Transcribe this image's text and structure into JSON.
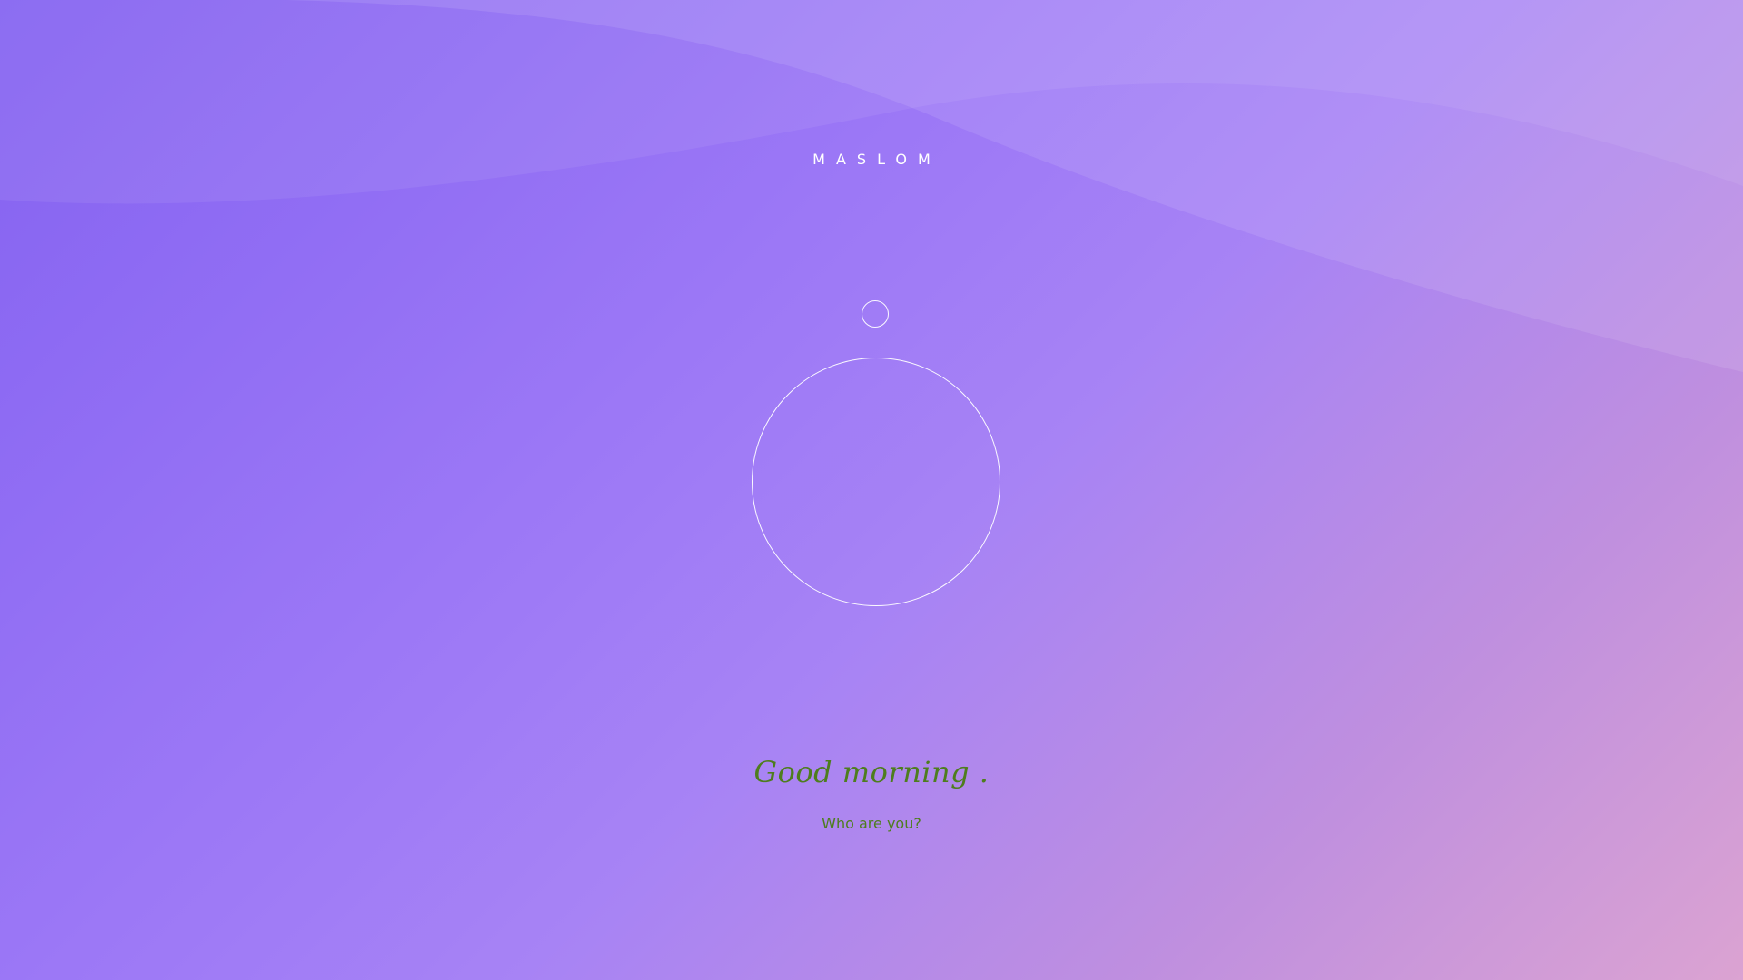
{
  "app": {
    "brand": "MASLOM"
  },
  "welcome": {
    "greeting": "Good morning .",
    "question": "Who are you?"
  },
  "colors": {
    "background_start": "#8462f1",
    "background_end": "#dba3d2",
    "text_accent": "#4e7d1e",
    "ring": "#ffffff"
  }
}
